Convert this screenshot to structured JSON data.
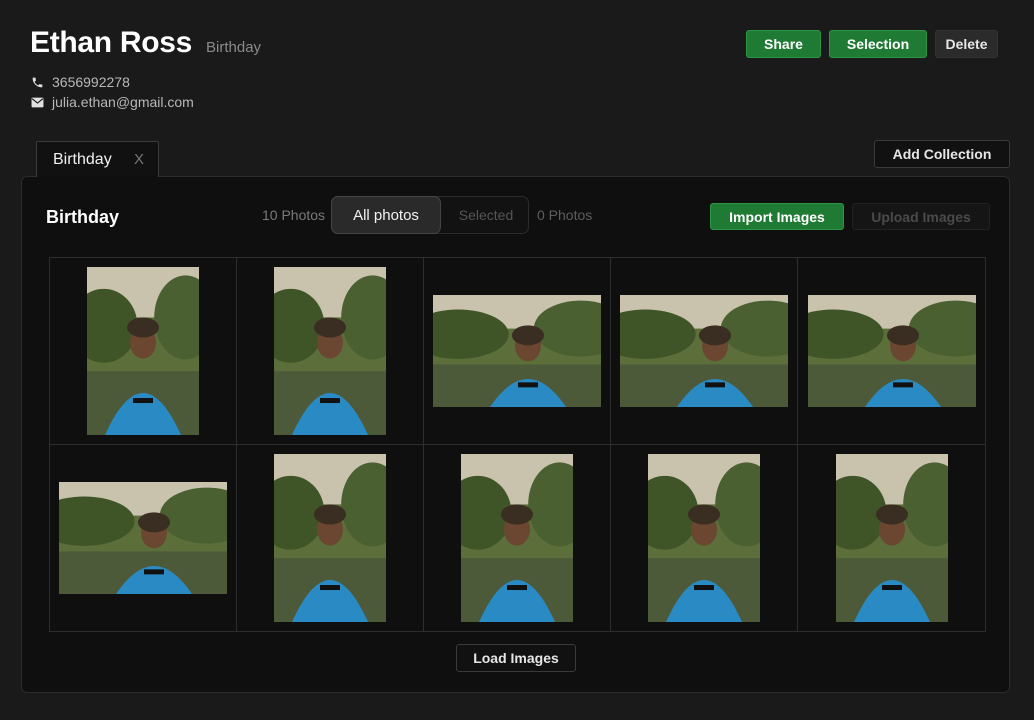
{
  "client": {
    "name": "Ethan Ross",
    "event": "Birthday",
    "phone": "3656992278",
    "email": "julia.ethan@gmail.com"
  },
  "actions": {
    "share": "Share",
    "selection": "Selection",
    "delete": "Delete"
  },
  "tab": {
    "label": "Birthday",
    "close": "X"
  },
  "add_collection": "Add Collection",
  "panel": {
    "title": "Birthday",
    "photos_count": "10 Photos",
    "filter_all": "All photos",
    "filter_selected": "Selected",
    "selected_count": "0 Photos",
    "import": "Import Images",
    "upload": "Upload Images",
    "load_more": "Load Images"
  },
  "photos": [
    {
      "orientation": "portrait"
    },
    {
      "orientation": "portrait"
    },
    {
      "orientation": "landscape"
    },
    {
      "orientation": "landscape"
    },
    {
      "orientation": "landscape"
    },
    {
      "orientation": "landscape"
    },
    {
      "orientation": "portrait"
    },
    {
      "orientation": "portrait"
    },
    {
      "orientation": "portrait"
    },
    {
      "orientation": "portrait"
    }
  ],
  "colors": {
    "accent_green": "#1f7a34",
    "background": "#1a1a1a",
    "panel": "#0f0f0f",
    "shirt_blue": "#2a8bc4"
  }
}
